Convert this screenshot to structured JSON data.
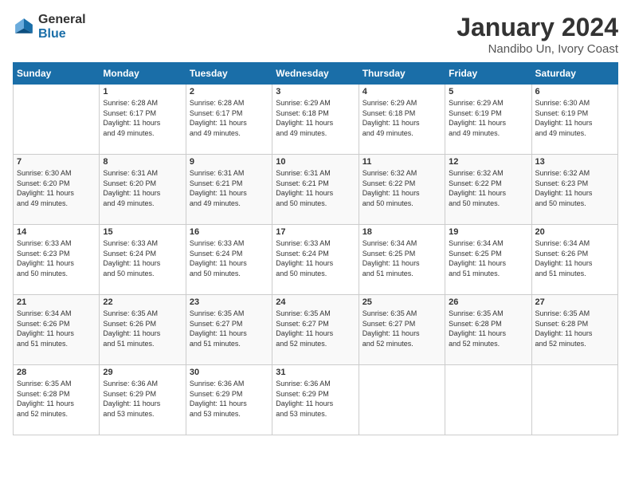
{
  "header": {
    "logo_line1": "General",
    "logo_line2": "Blue",
    "title": "January 2024",
    "subtitle": "Nandibo Un, Ivory Coast"
  },
  "weekdays": [
    "Sunday",
    "Monday",
    "Tuesday",
    "Wednesday",
    "Thursday",
    "Friday",
    "Saturday"
  ],
  "weeks": [
    [
      {
        "day": "",
        "sunrise": "",
        "sunset": "",
        "daylight": ""
      },
      {
        "day": "1",
        "sunrise": "Sunrise: 6:28 AM",
        "sunset": "Sunset: 6:17 PM",
        "daylight": "Daylight: 11 hours and 49 minutes."
      },
      {
        "day": "2",
        "sunrise": "Sunrise: 6:28 AM",
        "sunset": "Sunset: 6:17 PM",
        "daylight": "Daylight: 11 hours and 49 minutes."
      },
      {
        "day": "3",
        "sunrise": "Sunrise: 6:29 AM",
        "sunset": "Sunset: 6:18 PM",
        "daylight": "Daylight: 11 hours and 49 minutes."
      },
      {
        "day": "4",
        "sunrise": "Sunrise: 6:29 AM",
        "sunset": "Sunset: 6:18 PM",
        "daylight": "Daylight: 11 hours and 49 minutes."
      },
      {
        "day": "5",
        "sunrise": "Sunrise: 6:29 AM",
        "sunset": "Sunset: 6:19 PM",
        "daylight": "Daylight: 11 hours and 49 minutes."
      },
      {
        "day": "6",
        "sunrise": "Sunrise: 6:30 AM",
        "sunset": "Sunset: 6:19 PM",
        "daylight": "Daylight: 11 hours and 49 minutes."
      }
    ],
    [
      {
        "day": "7",
        "sunrise": "Sunrise: 6:30 AM",
        "sunset": "Sunset: 6:20 PM",
        "daylight": "Daylight: 11 hours and 49 minutes."
      },
      {
        "day": "8",
        "sunrise": "Sunrise: 6:31 AM",
        "sunset": "Sunset: 6:20 PM",
        "daylight": "Daylight: 11 hours and 49 minutes."
      },
      {
        "day": "9",
        "sunrise": "Sunrise: 6:31 AM",
        "sunset": "Sunset: 6:21 PM",
        "daylight": "Daylight: 11 hours and 49 minutes."
      },
      {
        "day": "10",
        "sunrise": "Sunrise: 6:31 AM",
        "sunset": "Sunset: 6:21 PM",
        "daylight": "Daylight: 11 hours and 50 minutes."
      },
      {
        "day": "11",
        "sunrise": "Sunrise: 6:32 AM",
        "sunset": "Sunset: 6:22 PM",
        "daylight": "Daylight: 11 hours and 50 minutes."
      },
      {
        "day": "12",
        "sunrise": "Sunrise: 6:32 AM",
        "sunset": "Sunset: 6:22 PM",
        "daylight": "Daylight: 11 hours and 50 minutes."
      },
      {
        "day": "13",
        "sunrise": "Sunrise: 6:32 AM",
        "sunset": "Sunset: 6:23 PM",
        "daylight": "Daylight: 11 hours and 50 minutes."
      }
    ],
    [
      {
        "day": "14",
        "sunrise": "Sunrise: 6:33 AM",
        "sunset": "Sunset: 6:23 PM",
        "daylight": "Daylight: 11 hours and 50 minutes."
      },
      {
        "day": "15",
        "sunrise": "Sunrise: 6:33 AM",
        "sunset": "Sunset: 6:24 PM",
        "daylight": "Daylight: 11 hours and 50 minutes."
      },
      {
        "day": "16",
        "sunrise": "Sunrise: 6:33 AM",
        "sunset": "Sunset: 6:24 PM",
        "daylight": "Daylight: 11 hours and 50 minutes."
      },
      {
        "day": "17",
        "sunrise": "Sunrise: 6:33 AM",
        "sunset": "Sunset: 6:24 PM",
        "daylight": "Daylight: 11 hours and 50 minutes."
      },
      {
        "day": "18",
        "sunrise": "Sunrise: 6:34 AM",
        "sunset": "Sunset: 6:25 PM",
        "daylight": "Daylight: 11 hours and 51 minutes."
      },
      {
        "day": "19",
        "sunrise": "Sunrise: 6:34 AM",
        "sunset": "Sunset: 6:25 PM",
        "daylight": "Daylight: 11 hours and 51 minutes."
      },
      {
        "day": "20",
        "sunrise": "Sunrise: 6:34 AM",
        "sunset": "Sunset: 6:26 PM",
        "daylight": "Daylight: 11 hours and 51 minutes."
      }
    ],
    [
      {
        "day": "21",
        "sunrise": "Sunrise: 6:34 AM",
        "sunset": "Sunset: 6:26 PM",
        "daylight": "Daylight: 11 hours and 51 minutes."
      },
      {
        "day": "22",
        "sunrise": "Sunrise: 6:35 AM",
        "sunset": "Sunset: 6:26 PM",
        "daylight": "Daylight: 11 hours and 51 minutes."
      },
      {
        "day": "23",
        "sunrise": "Sunrise: 6:35 AM",
        "sunset": "Sunset: 6:27 PM",
        "daylight": "Daylight: 11 hours and 51 minutes."
      },
      {
        "day": "24",
        "sunrise": "Sunrise: 6:35 AM",
        "sunset": "Sunset: 6:27 PM",
        "daylight": "Daylight: 11 hours and 52 minutes."
      },
      {
        "day": "25",
        "sunrise": "Sunrise: 6:35 AM",
        "sunset": "Sunset: 6:27 PM",
        "daylight": "Daylight: 11 hours and 52 minutes."
      },
      {
        "day": "26",
        "sunrise": "Sunrise: 6:35 AM",
        "sunset": "Sunset: 6:28 PM",
        "daylight": "Daylight: 11 hours and 52 minutes."
      },
      {
        "day": "27",
        "sunrise": "Sunrise: 6:35 AM",
        "sunset": "Sunset: 6:28 PM",
        "daylight": "Daylight: 11 hours and 52 minutes."
      }
    ],
    [
      {
        "day": "28",
        "sunrise": "Sunrise: 6:35 AM",
        "sunset": "Sunset: 6:28 PM",
        "daylight": "Daylight: 11 hours and 52 minutes."
      },
      {
        "day": "29",
        "sunrise": "Sunrise: 6:36 AM",
        "sunset": "Sunset: 6:29 PM",
        "daylight": "Daylight: 11 hours and 53 minutes."
      },
      {
        "day": "30",
        "sunrise": "Sunrise: 6:36 AM",
        "sunset": "Sunset: 6:29 PM",
        "daylight": "Daylight: 11 hours and 53 minutes."
      },
      {
        "day": "31",
        "sunrise": "Sunrise: 6:36 AM",
        "sunset": "Sunset: 6:29 PM",
        "daylight": "Daylight: 11 hours and 53 minutes."
      },
      {
        "day": "",
        "sunrise": "",
        "sunset": "",
        "daylight": ""
      },
      {
        "day": "",
        "sunrise": "",
        "sunset": "",
        "daylight": ""
      },
      {
        "day": "",
        "sunrise": "",
        "sunset": "",
        "daylight": ""
      }
    ]
  ]
}
